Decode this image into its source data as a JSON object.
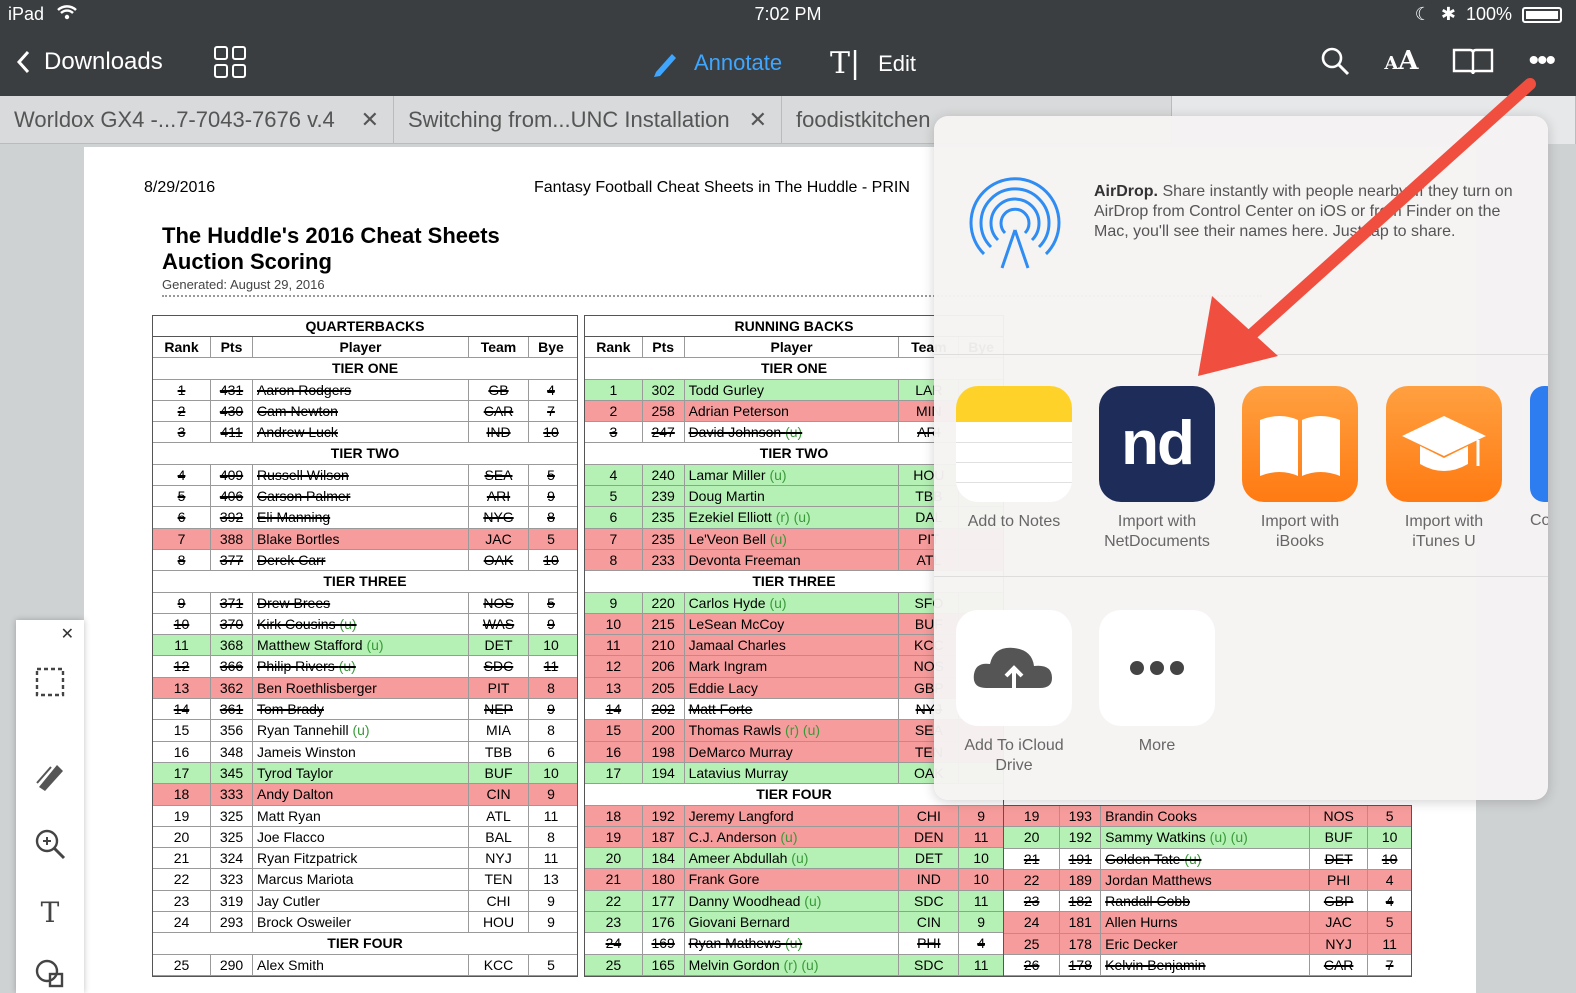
{
  "status": {
    "device": "iPad",
    "time": "7:02 PM",
    "battery": "100%"
  },
  "nav": {
    "back_label": "Downloads",
    "annotate_label": "Annotate",
    "edit_label": "Edit"
  },
  "tabs": [
    {
      "label": "Worldox GX4 -...7-7043-7676 v.4"
    },
    {
      "label": "Switching from...UNC Installation"
    },
    {
      "label": "foodistkitchen"
    },
    {
      "label": ""
    }
  ],
  "document": {
    "date": "8/29/2016",
    "header_title": "Fantasy Football Cheat Sheets in The Huddle - PRIN",
    "heading_line1": "The Huddle's 2016 Cheat Sheets",
    "heading_line2": "Auction Scoring",
    "generated": "Generated: August 29, 2016",
    "columns": {
      "rank": "Rank",
      "pts": "Pts",
      "player": "Player",
      "team": "Team",
      "bye": "Bye"
    },
    "qb": {
      "title": "QUARTERBACKS",
      "tiers": [
        {
          "label": "TIER ONE",
          "rows": [
            {
              "rank": "1",
              "pts": "431",
              "player": "Aaron Rodgers",
              "team": "GB",
              "bye": "4",
              "mark": "strike"
            },
            {
              "rank": "2",
              "pts": "430",
              "player": "Cam Newton",
              "team": "CAR",
              "bye": "7",
              "mark": "strike"
            },
            {
              "rank": "3",
              "pts": "411",
              "player": "Andrew Luck",
              "team": "IND",
              "bye": "10",
              "mark": "strike"
            }
          ]
        },
        {
          "label": "TIER TWO",
          "rows": [
            {
              "rank": "4",
              "pts": "409",
              "player": "Russell Wilson",
              "team": "SEA",
              "bye": "5",
              "mark": "strike"
            },
            {
              "rank": "5",
              "pts": "406",
              "player": "Carson Palmer",
              "team": "ARI",
              "bye": "9",
              "mark": "strike"
            },
            {
              "rank": "6",
              "pts": "392",
              "player": "Eli Manning",
              "team": "NYG",
              "bye": "8",
              "mark": "strike"
            },
            {
              "rank": "7",
              "pts": "388",
              "player": "Blake Bortles",
              "team": "JAC",
              "bye": "5",
              "mark": "red"
            },
            {
              "rank": "8",
              "pts": "377",
              "player": "Derek Carr",
              "team": "OAK",
              "bye": "10",
              "mark": "strike"
            }
          ]
        },
        {
          "label": "TIER THREE",
          "rows": [
            {
              "rank": "9",
              "pts": "371",
              "player": "Drew Brees",
              "team": "NOS",
              "bye": "5",
              "mark": "strike"
            },
            {
              "rank": "10",
              "pts": "370",
              "player": "Kirk Cousins",
              "u": "(u)",
              "team": "WAS",
              "bye": "9",
              "mark": "strike"
            },
            {
              "rank": "11",
              "pts": "368",
              "player": "Matthew Stafford",
              "u": "(u)",
              "team": "DET",
              "bye": "10",
              "mark": "green"
            },
            {
              "rank": "12",
              "pts": "366",
              "player": "Philip Rivers",
              "u": "(u)",
              "team": "SDC",
              "bye": "11",
              "mark": "strike"
            },
            {
              "rank": "13",
              "pts": "362",
              "player": "Ben Roethlisberger",
              "team": "PIT",
              "bye": "8",
              "mark": "red"
            },
            {
              "rank": "14",
              "pts": "361",
              "player": "Tom Brady",
              "team": "NEP",
              "bye": "9",
              "mark": "strike"
            },
            {
              "rank": "15",
              "pts": "356",
              "player": "Ryan Tannehill",
              "u": "(u)",
              "team": "MIA",
              "bye": "8",
              "mark": ""
            },
            {
              "rank": "16",
              "pts": "348",
              "player": "Jameis Winston",
              "team": "TBB",
              "bye": "6",
              "mark": ""
            },
            {
              "rank": "17",
              "pts": "345",
              "player": "Tyrod Taylor",
              "team": "BUF",
              "bye": "10",
              "mark": "green"
            },
            {
              "rank": "18",
              "pts": "333",
              "player": "Andy Dalton",
              "team": "CIN",
              "bye": "9",
              "mark": "red"
            },
            {
              "rank": "19",
              "pts": "325",
              "player": "Matt Ryan",
              "team": "ATL",
              "bye": "11",
              "mark": ""
            },
            {
              "rank": "20",
              "pts": "325",
              "player": "Joe Flacco",
              "team": "BAL",
              "bye": "8",
              "mark": ""
            },
            {
              "rank": "21",
              "pts": "324",
              "player": "Ryan Fitzpatrick",
              "team": "NYJ",
              "bye": "11",
              "mark": ""
            },
            {
              "rank": "22",
              "pts": "323",
              "player": "Marcus Mariota",
              "team": "TEN",
              "bye": "13",
              "mark": ""
            },
            {
              "rank": "23",
              "pts": "319",
              "player": "Jay Cutler",
              "team": "CHI",
              "bye": "9",
              "mark": ""
            },
            {
              "rank": "24",
              "pts": "293",
              "player": "Brock Osweiler",
              "team": "HOU",
              "bye": "9",
              "mark": ""
            }
          ]
        },
        {
          "label": "TIER FOUR",
          "rows": [
            {
              "rank": "25",
              "pts": "290",
              "player": "Alex Smith",
              "team": "KCC",
              "bye": "5",
              "mark": ""
            }
          ]
        }
      ]
    },
    "rb": {
      "title": "RUNNING BACKS",
      "tiers": [
        {
          "label": "TIER ONE",
          "rows": [
            {
              "rank": "1",
              "pts": "302",
              "player": "Todd Gurley",
              "team": "LAR",
              "mark": "green"
            },
            {
              "rank": "2",
              "pts": "258",
              "player": "Adrian Peterson",
              "team": "MIN",
              "mark": "red"
            },
            {
              "rank": "3",
              "pts": "247",
              "player": "David Johnson",
              "u": "(u)",
              "team": "ARI",
              "mark": "strike"
            }
          ]
        },
        {
          "label": "TIER TWO",
          "rows": [
            {
              "rank": "4",
              "pts": "240",
              "player": "Lamar Miller",
              "u": "(u)",
              "team": "HOU",
              "mark": "green"
            },
            {
              "rank": "5",
              "pts": "239",
              "player": "Doug Martin",
              "team": "TBB",
              "mark": "green"
            },
            {
              "rank": "6",
              "pts": "235",
              "player": "Ezekiel Elliott",
              "u": "(r) (u)",
              "team": "DAL",
              "mark": "green"
            },
            {
              "rank": "7",
              "pts": "235",
              "player": "Le'Veon Bell",
              "u": "(u)",
              "team": "PIT",
              "mark": "red"
            },
            {
              "rank": "8",
              "pts": "233",
              "player": "Devonta Freeman",
              "team": "ATL",
              "mark": "red"
            }
          ]
        },
        {
          "label": "TIER THREE",
          "rows": [
            {
              "rank": "9",
              "pts": "220",
              "player": "Carlos Hyde",
              "u": "(u)",
              "team": "SFO",
              "mark": "green"
            },
            {
              "rank": "10",
              "pts": "215",
              "player": "LeSean McCoy",
              "team": "BUF",
              "mark": "red"
            },
            {
              "rank": "11",
              "pts": "210",
              "player": "Jamaal Charles",
              "team": "KCC",
              "mark": "red"
            },
            {
              "rank": "12",
              "pts": "206",
              "player": "Mark Ingram",
              "team": "NOS",
              "mark": "red"
            },
            {
              "rank": "13",
              "pts": "205",
              "player": "Eddie Lacy",
              "team": "GBP",
              "mark": "red"
            },
            {
              "rank": "14",
              "pts": "202",
              "player": "Matt Forte",
              "team": "NYJ",
              "mark": "strike"
            },
            {
              "rank": "15",
              "pts": "200",
              "player": "Thomas Rawls",
              "u": "(r) (u)",
              "team": "SEA",
              "mark": "red"
            },
            {
              "rank": "16",
              "pts": "198",
              "player": "DeMarco Murray",
              "team": "TEN",
              "mark": "red"
            },
            {
              "rank": "17",
              "pts": "194",
              "player": "Latavius Murray",
              "team": "OAK",
              "mark": "green"
            }
          ]
        },
        {
          "label": "TIER FOUR",
          "rows": [
            {
              "rank": "18",
              "pts": "192",
              "player": "Jeremy Langford",
              "team": "CHI",
              "bye": "9",
              "mark": "red"
            },
            {
              "rank": "19",
              "pts": "187",
              "player": "C.J. Anderson",
              "u": "(u)",
              "team": "DEN",
              "bye": "11",
              "mark": "red"
            },
            {
              "rank": "20",
              "pts": "184",
              "player": "Ameer Abdullah",
              "u": "(u)",
              "team": "DET",
              "bye": "10",
              "mark": "green"
            },
            {
              "rank": "21",
              "pts": "180",
              "player": "Frank Gore",
              "team": "IND",
              "bye": "10",
              "mark": "red"
            },
            {
              "rank": "22",
              "pts": "177",
              "player": "Danny Woodhead",
              "u": "(u)",
              "team": "SDC",
              "bye": "11",
              "mark": "green"
            },
            {
              "rank": "23",
              "pts": "176",
              "player": "Giovani Bernard",
              "team": "CIN",
              "bye": "9",
              "mark": "green"
            },
            {
              "rank": "24",
              "pts": "169",
              "player": "Ryan Mathews",
              "u": "(u)",
              "team": "PHI",
              "bye": "4",
              "mark": "strike"
            },
            {
              "rank": "25",
              "pts": "165",
              "player": "Melvin Gordon",
              "u": "(r) (u)",
              "team": "SDC",
              "bye": "11",
              "mark": "green"
            }
          ]
        }
      ]
    },
    "wr_partial": [
      {
        "rank": "19",
        "pts": "193",
        "player": "Brandin Cooks",
        "team": "NOS",
        "bye": "5",
        "mark": "red"
      },
      {
        "rank": "20",
        "pts": "192",
        "player": "Sammy Watkins",
        "u": "(u) (u)",
        "team": "BUF",
        "bye": "10",
        "mark": "green"
      },
      {
        "rank": "21",
        "pts": "191",
        "player": "Golden Tate",
        "u": "(u)",
        "team": "DET",
        "bye": "10",
        "mark": "strike"
      },
      {
        "rank": "22",
        "pts": "189",
        "player": "Jordan Matthews",
        "team": "PHI",
        "bye": "4",
        "mark": "red"
      },
      {
        "rank": "23",
        "pts": "182",
        "player": "Randall Cobb",
        "team": "GBP",
        "bye": "4",
        "mark": "strike"
      },
      {
        "rank": "24",
        "pts": "181",
        "player": "Allen Hurns",
        "team": "JAC",
        "bye": "5",
        "mark": "red"
      },
      {
        "rank": "25",
        "pts": "178",
        "player": "Eric Decker",
        "team": "NYJ",
        "bye": "11",
        "mark": "red"
      },
      {
        "rank": "26",
        "pts": "178",
        "player": "Kelvin Benjamin",
        "team": "CAR",
        "bye": "7",
        "mark": "strike"
      }
    ]
  },
  "share_sheet": {
    "airdrop_title": "AirDrop.",
    "airdrop_text": "Share instantly with people nearby. If they turn on AirDrop from Control Center on iOS or from Finder on the Mac, you'll see their names here. Just tap to share.",
    "apps": [
      {
        "label_1": "Add to Notes",
        "label_2": "",
        "icon": "notes-icon"
      },
      {
        "label_1": "Import with",
        "label_2": "NetDocuments",
        "icon": "netdocuments-icon",
        "badge": "nd"
      },
      {
        "label_1": "Import with",
        "label_2": "iBooks",
        "icon": "ibooks-icon"
      },
      {
        "label_1": "Import with",
        "label_2": "iTunes U",
        "icon": "itunes-u-icon"
      }
    ],
    "partial_app_label": "Co",
    "actions": [
      {
        "label_1": "Add To iCloud",
        "label_2": "Drive",
        "icon": "icloud-upload-icon"
      },
      {
        "label_1": "More",
        "label_2": "",
        "icon": "more-dots-icon"
      }
    ]
  },
  "colors": {
    "accent": "#3fa6ff",
    "navbar": "#3a3e41",
    "highlight_green": "#7fe67f",
    "highlight_red": "#f05a5a",
    "arrow": "#f04e3e",
    "netdocuments": "#1d2c59"
  }
}
